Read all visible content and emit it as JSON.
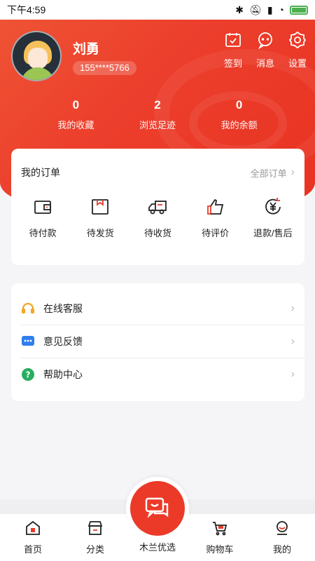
{
  "status": {
    "time": "下午4:59"
  },
  "profile": {
    "name": "刘勇",
    "phone": "155****5766"
  },
  "top_actions": [
    {
      "label": "签到",
      "icon": "calendar-check-icon"
    },
    {
      "label": "消息",
      "icon": "chat-bubble-icon"
    },
    {
      "label": "设置",
      "icon": "gear-icon"
    }
  ],
  "stats": [
    {
      "value": "0",
      "label": "我的收藏"
    },
    {
      "value": "2",
      "label": "浏览足迹"
    },
    {
      "value": "0",
      "label": "我的余额"
    }
  ],
  "orders": {
    "title": "我的订单",
    "more": "全部订单",
    "items": [
      {
        "label": "待付款",
        "icon": "wallet-icon"
      },
      {
        "label": "待发货",
        "icon": "box-icon"
      },
      {
        "label": "待收货",
        "icon": "truck-icon"
      },
      {
        "label": "待评价",
        "icon": "thumbs-up-icon"
      },
      {
        "label": "退款/售后",
        "icon": "yen-refund-icon"
      }
    ]
  },
  "services": [
    {
      "label": "在线客服",
      "icon": "headset-icon",
      "color": "#f5a623"
    },
    {
      "label": "意见反馈",
      "icon": "feedback-icon",
      "color": "#2f80ed"
    },
    {
      "label": "帮助中心",
      "icon": "help-icon",
      "color": "#27ae60"
    }
  ],
  "nav": {
    "items": [
      {
        "label": "首页",
        "icon": "home-icon"
      },
      {
        "label": "分类",
        "icon": "store-icon"
      },
      {
        "label": "购物车",
        "icon": "cart-icon"
      },
      {
        "label": "我的",
        "icon": "profile-icon"
      }
    ],
    "center": {
      "label": "木兰优选",
      "icon": "chat-smile-icon"
    }
  },
  "colors": {
    "accent": "#ec3a29"
  }
}
